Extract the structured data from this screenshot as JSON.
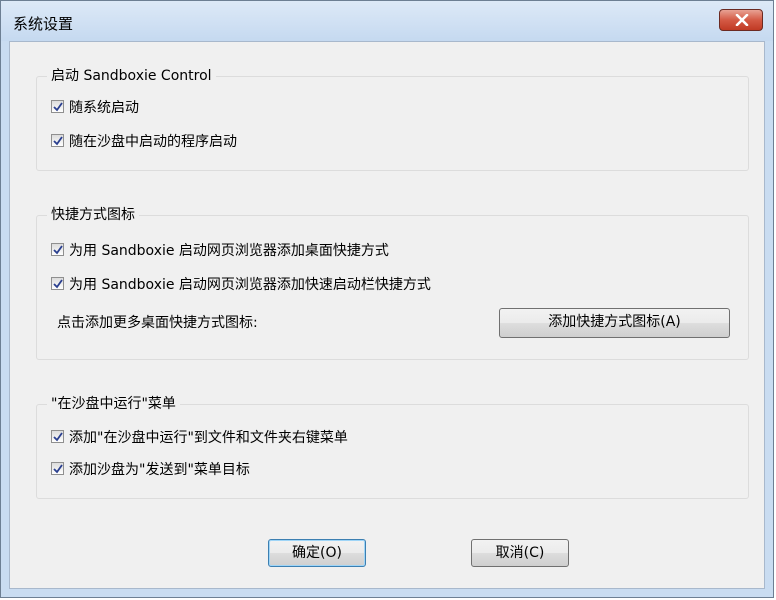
{
  "window": {
    "title": "系统设置"
  },
  "startup_group": {
    "legend": "启动 Sandboxie Control",
    "items": [
      {
        "label": "随系统启动",
        "checked": true
      },
      {
        "label": "随在沙盘中启动的程序启动",
        "checked": true
      }
    ]
  },
  "shortcut_group": {
    "legend": "快捷方式图标",
    "items": [
      {
        "label": "为用 Sandboxie 启动网页浏览器添加桌面快捷方式",
        "checked": true
      },
      {
        "label": "为用 Sandboxie 启动网页浏览器添加快速启动栏快捷方式",
        "checked": true
      }
    ],
    "more_text": "点击添加更多桌面快捷方式图标:",
    "add_button_label": "添加快捷方式图标(A)"
  },
  "menu_group": {
    "legend": "\"在沙盘中运行\"菜单",
    "items": [
      {
        "label": "添加\"在沙盘中运行\"到文件和文件夹右键菜单",
        "checked": true
      },
      {
        "label": "添加沙盘为\"发送到\"菜单目标",
        "checked": true
      }
    ]
  },
  "footer": {
    "ok_label": "确定(O)",
    "cancel_label": "取消(C)"
  },
  "icons": {
    "close": "close-icon",
    "check": "checkmark-icon"
  }
}
